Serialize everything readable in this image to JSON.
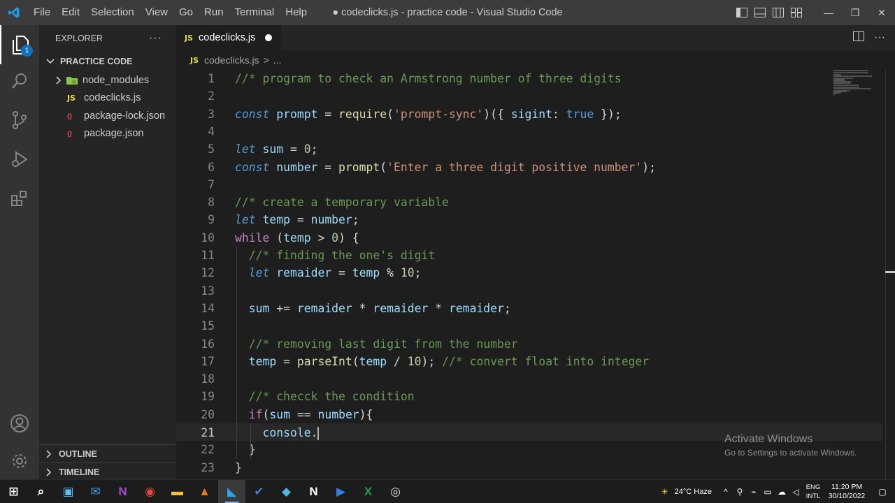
{
  "titlebar": {
    "menu": [
      "File",
      "Edit",
      "Selection",
      "View",
      "Go",
      "Run",
      "Terminal",
      "Help"
    ],
    "window_title": "● codeclicks.js - practice code - Visual Studio Code",
    "minimize": "—",
    "maximize": "❐",
    "close": "✕"
  },
  "activitybar": {
    "icons": [
      "files-icon",
      "search-icon",
      "source-control-icon",
      "run-debug-icon",
      "extensions-icon",
      "account-icon",
      "settings-gear-icon"
    ],
    "explorer_badge": "1"
  },
  "sidebar": {
    "header": "EXPLORER",
    "more": "···",
    "project": "PRACTICE CODE",
    "tree": [
      {
        "name": "node_modules",
        "type": "folder"
      },
      {
        "name": "codeclicks.js",
        "type": "js",
        "badge": "JS"
      },
      {
        "name": "package-lock.json",
        "type": "json",
        "badge": "{}"
      },
      {
        "name": "package.json",
        "type": "json",
        "badge": "{}"
      }
    ],
    "outline": "OUTLINE",
    "timeline": "TIMELINE"
  },
  "editor": {
    "tab": {
      "badge": "JS",
      "label": "codeclicks.js"
    },
    "breadcrumb": {
      "badge": "JS",
      "file": "codeclicks.js",
      "sep": ">",
      "more": "..."
    },
    "current_line": 21,
    "lines": [
      {
        "n": "1",
        "tokens": [
          [
            "c-comment",
            "//* program to check an Armstrong number of three digits"
          ]
        ]
      },
      {
        "n": "2",
        "tokens": []
      },
      {
        "n": "3",
        "tokens": [
          [
            "c-kw",
            "const"
          ],
          [
            "c-op",
            " "
          ],
          [
            "c-var",
            "prompt"
          ],
          [
            "c-op",
            " = "
          ],
          [
            "c-fn",
            "require"
          ],
          [
            "c-op",
            "("
          ],
          [
            "c-str",
            "'prompt-sync'"
          ],
          [
            "c-op",
            ")({ "
          ],
          [
            "c-var",
            "sigint"
          ],
          [
            "c-op",
            ": "
          ],
          [
            "c-bool",
            "true"
          ],
          [
            "c-op",
            " });"
          ]
        ]
      },
      {
        "n": "4",
        "tokens": []
      },
      {
        "n": "5",
        "tokens": [
          [
            "c-kw",
            "let"
          ],
          [
            "c-op",
            " "
          ],
          [
            "c-var",
            "sum"
          ],
          [
            "c-op",
            " = "
          ],
          [
            "c-num",
            "0"
          ],
          [
            "c-op",
            ";"
          ]
        ]
      },
      {
        "n": "6",
        "tokens": [
          [
            "c-kw",
            "const"
          ],
          [
            "c-op",
            " "
          ],
          [
            "c-var",
            "number"
          ],
          [
            "c-op",
            " = "
          ],
          [
            "c-fn",
            "prompt"
          ],
          [
            "c-op",
            "("
          ],
          [
            "c-str",
            "'Enter a three digit positive number'"
          ],
          [
            "c-op",
            ");"
          ]
        ]
      },
      {
        "n": "7",
        "tokens": []
      },
      {
        "n": "8",
        "tokens": [
          [
            "c-comment",
            "//* create a temporary variable"
          ]
        ]
      },
      {
        "n": "9",
        "tokens": [
          [
            "c-kw",
            "let"
          ],
          [
            "c-op",
            " "
          ],
          [
            "c-var",
            "temp"
          ],
          [
            "c-op",
            " = "
          ],
          [
            "c-var",
            "number"
          ],
          [
            "c-op",
            ";"
          ]
        ]
      },
      {
        "n": "10",
        "tokens": [
          [
            "c-ctrl",
            "while"
          ],
          [
            "c-op",
            " ("
          ],
          [
            "c-var",
            "temp"
          ],
          [
            "c-op",
            " > "
          ],
          [
            "c-num",
            "0"
          ],
          [
            "c-op",
            ") {"
          ]
        ]
      },
      {
        "n": "11",
        "tokens": [
          [
            "c-op",
            "  "
          ],
          [
            "c-comment",
            "//* finding the one's digit"
          ]
        ]
      },
      {
        "n": "12",
        "tokens": [
          [
            "c-op",
            "  "
          ],
          [
            "c-kw",
            "let"
          ],
          [
            "c-op",
            " "
          ],
          [
            "c-var",
            "remaider"
          ],
          [
            "c-op",
            " = "
          ],
          [
            "c-var",
            "temp"
          ],
          [
            "c-op",
            " % "
          ],
          [
            "c-num",
            "10"
          ],
          [
            "c-op",
            ";"
          ]
        ]
      },
      {
        "n": "13",
        "tokens": []
      },
      {
        "n": "14",
        "tokens": [
          [
            "c-op",
            "  "
          ],
          [
            "c-var",
            "sum"
          ],
          [
            "c-op",
            " += "
          ],
          [
            "c-var",
            "remaider"
          ],
          [
            "c-op",
            " * "
          ],
          [
            "c-var",
            "remaider"
          ],
          [
            "c-op",
            " * "
          ],
          [
            "c-var",
            "remaider"
          ],
          [
            "c-op",
            ";"
          ]
        ]
      },
      {
        "n": "15",
        "tokens": []
      },
      {
        "n": "16",
        "tokens": [
          [
            "c-op",
            "  "
          ],
          [
            "c-comment",
            "//* removing last digit from the number"
          ]
        ]
      },
      {
        "n": "17",
        "tokens": [
          [
            "c-op",
            "  "
          ],
          [
            "c-var",
            "temp"
          ],
          [
            "c-op",
            " = "
          ],
          [
            "c-fn",
            "parseInt"
          ],
          [
            "c-op",
            "("
          ],
          [
            "c-var",
            "temp"
          ],
          [
            "c-op",
            " / "
          ],
          [
            "c-num",
            "10"
          ],
          [
            "c-op",
            "); "
          ],
          [
            "c-comment",
            "//* convert float into integer"
          ]
        ]
      },
      {
        "n": "18",
        "tokens": []
      },
      {
        "n": "19",
        "tokens": [
          [
            "c-op",
            "  "
          ],
          [
            "c-comment",
            "//* checck the condition"
          ]
        ]
      },
      {
        "n": "20",
        "tokens": [
          [
            "c-op",
            "  "
          ],
          [
            "c-ctrl",
            "if"
          ],
          [
            "c-op",
            "("
          ],
          [
            "c-var",
            "sum"
          ],
          [
            "c-op",
            " == "
          ],
          [
            "c-var",
            "number"
          ],
          [
            "c-op",
            "){"
          ]
        ]
      },
      {
        "n": "21",
        "tokens": [
          [
            "c-op",
            "    "
          ],
          [
            "c-var",
            "console"
          ],
          [
            "c-op",
            "."
          ]
        ],
        "cursor": true
      },
      {
        "n": "22",
        "tokens": [
          [
            "c-op",
            "  }"
          ]
        ]
      },
      {
        "n": "23",
        "tokens": [
          [
            "c-op",
            "}"
          ]
        ]
      }
    ]
  },
  "watermark": {
    "title": "Activate Windows",
    "subtitle": "Go to Settings to activate Windows."
  },
  "taskbar": {
    "apps": [
      "windows-start-icon",
      "search-icon",
      "store-icon",
      "mail-icon",
      "onenote-icon",
      "chrome-icon",
      "file-explorer-icon",
      "vlc-icon",
      "vscode-icon",
      "todo-icon",
      "3d-viewer-icon",
      "notion-icon",
      "clipchamp-icon",
      "excel-icon",
      "obs-icon"
    ],
    "weather": "24°C Haze",
    "lang_top": "ENG",
    "lang_bottom": "INTL",
    "time": "11:20 PM",
    "date": "30/10/2022"
  },
  "colors": {
    "accent": "#0e70c0",
    "titlebar": "#3c3c3c",
    "activitybar": "#333333",
    "sidebar": "#252526",
    "editor": "#1e1e1e"
  }
}
